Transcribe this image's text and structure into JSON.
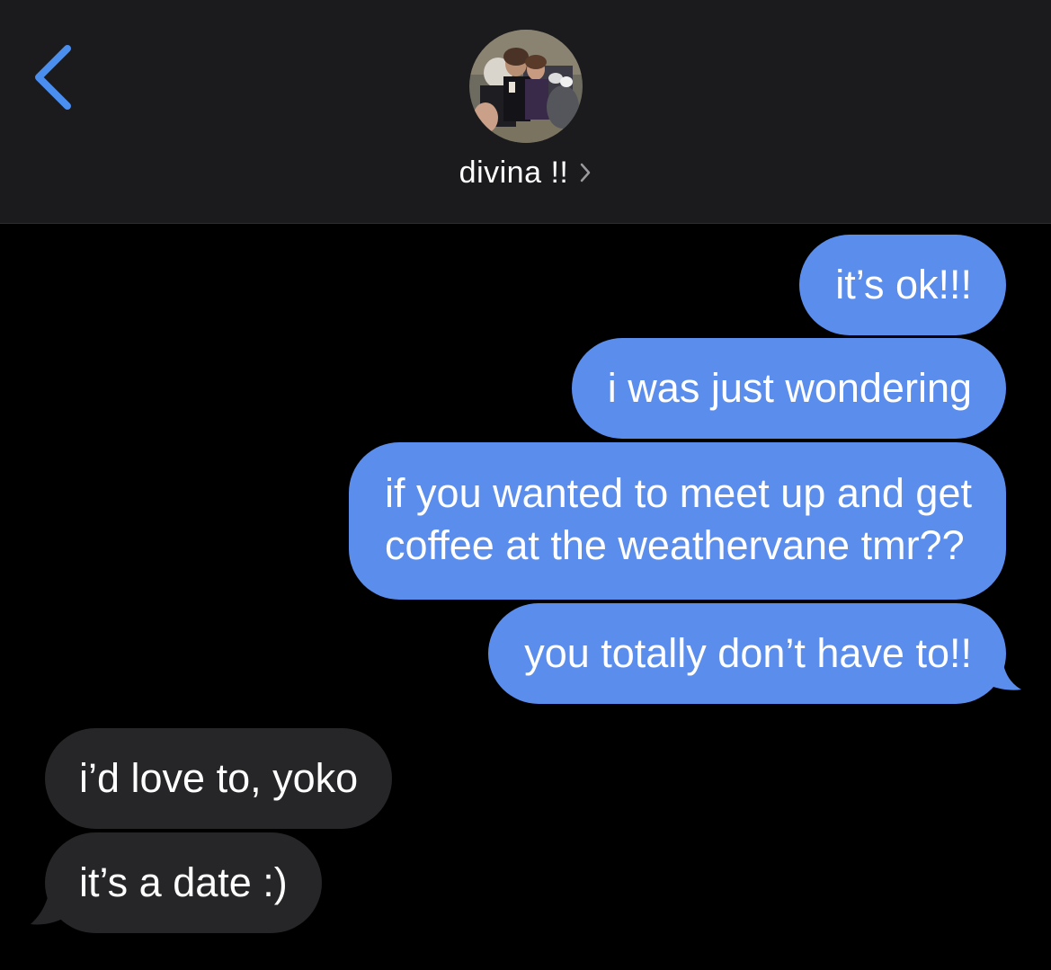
{
  "header": {
    "back_icon": "chevron-left-icon",
    "avatar_icon": "contact-photo",
    "contact_name": "divina !!",
    "name_chevron_icon": "chevron-right-icon"
  },
  "messages": {
    "sent": [
      {
        "text": "it’s ok!!!"
      },
      {
        "text": "i was just wondering"
      },
      {
        "lines": [
          "if you wanted to meet up and get",
          "coffee at the weathervane tmr??"
        ]
      },
      {
        "text": "you totally don’t have to!!"
      }
    ],
    "received": [
      {
        "text": "i’d love to, yoko"
      },
      {
        "text": "it’s a date :)"
      }
    ]
  },
  "colors": {
    "header_bg": "#1b1b1d",
    "background": "#000000",
    "sent_bubble": "#5b8ded",
    "received_bubble": "#262628",
    "accent": "#4a8ef0"
  }
}
